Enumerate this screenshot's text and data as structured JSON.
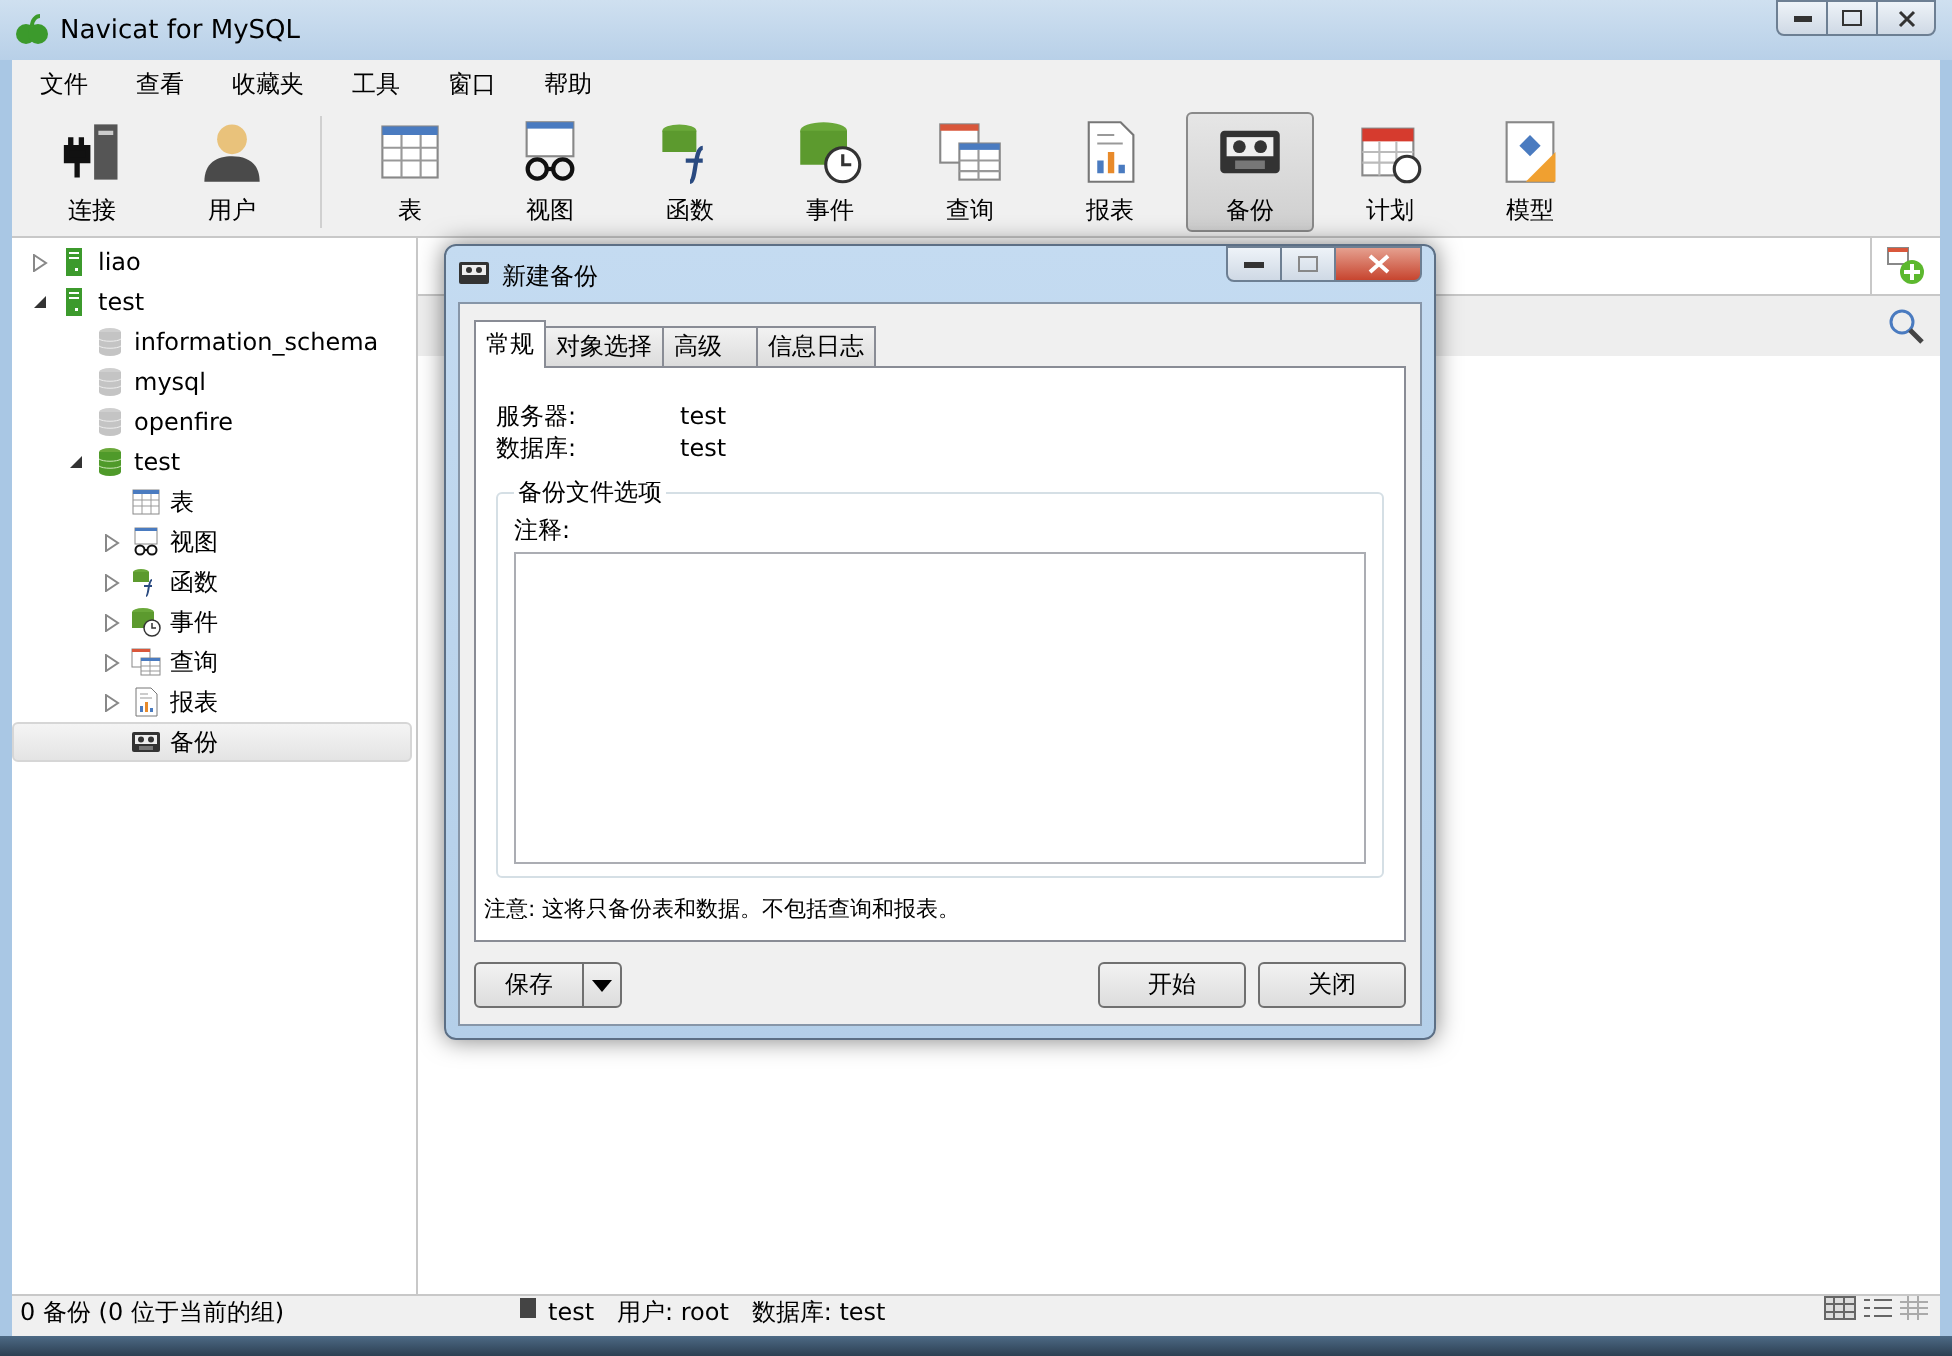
{
  "window": {
    "title": "Navicat for MySQL"
  },
  "menu": [
    "文件",
    "查看",
    "收藏夹",
    "工具",
    "窗口",
    "帮助"
  ],
  "toolbar": {
    "left": [
      {
        "label": "连接",
        "kind": "connection",
        "selected": false
      },
      {
        "label": "用户",
        "kind": "user",
        "selected": false
      }
    ],
    "main": [
      {
        "label": "表",
        "kind": "table",
        "selected": false
      },
      {
        "label": "视图",
        "kind": "view",
        "selected": false
      },
      {
        "label": "函数",
        "kind": "function",
        "selected": false
      },
      {
        "label": "事件",
        "kind": "event",
        "selected": false
      },
      {
        "label": "查询",
        "kind": "query",
        "selected": false
      },
      {
        "label": "报表",
        "kind": "report",
        "selected": false
      },
      {
        "label": "备份",
        "kind": "backup",
        "selected": true
      },
      {
        "label": "计划",
        "kind": "schedule",
        "selected": false
      },
      {
        "label": "模型",
        "kind": "model",
        "selected": false
      }
    ]
  },
  "tree": [
    {
      "label": "liao",
      "kind": "server",
      "expanded": false,
      "selected": false
    },
    {
      "label": "test",
      "kind": "server",
      "expanded": true,
      "selected": false,
      "children": [
        {
          "label": "information_schema",
          "kind": "database",
          "open": false,
          "selected": false
        },
        {
          "label": "mysql",
          "kind": "database",
          "open": false,
          "selected": false
        },
        {
          "label": "openfire",
          "kind": "database",
          "open": false,
          "selected": false
        },
        {
          "label": "test",
          "kind": "database",
          "open": true,
          "expanded": true,
          "selected": false,
          "children": [
            {
              "label": "表",
              "kind": "table",
              "selected": false
            },
            {
              "label": "视图",
              "kind": "view",
              "expanded": false,
              "selected": false
            },
            {
              "label": "函数",
              "kind": "function",
              "expanded": false,
              "selected": false
            },
            {
              "label": "事件",
              "kind": "event",
              "expanded": false,
              "selected": false
            },
            {
              "label": "查询",
              "kind": "query",
              "expanded": false,
              "selected": false
            },
            {
              "label": "报表",
              "kind": "report",
              "expanded": false,
              "selected": false
            },
            {
              "label": "备份",
              "kind": "backup",
              "selected": true
            }
          ]
        }
      ]
    }
  ],
  "dialog": {
    "title": "新建备份",
    "tabs": [
      {
        "label": "常规",
        "selected": true
      },
      {
        "label": "对象选择",
        "selected": false
      },
      {
        "label": "高级",
        "selected": false
      },
      {
        "label": "信息日志",
        "selected": false
      }
    ],
    "fields": [
      {
        "label": "服务器:",
        "value": "test"
      },
      {
        "label": "数据库:",
        "value": "test"
      }
    ],
    "group_title": "备份文件选项",
    "comment_label": "注释:",
    "note": "注意: 这将只备份表和数据。不包括查询和报表。",
    "save_button": "保存",
    "buttons": [
      "开始",
      "关闭"
    ]
  },
  "status_bar": {
    "left": "0 备份 (0 位于当前的组)",
    "right": "test   用户: root   数据库: test"
  }
}
